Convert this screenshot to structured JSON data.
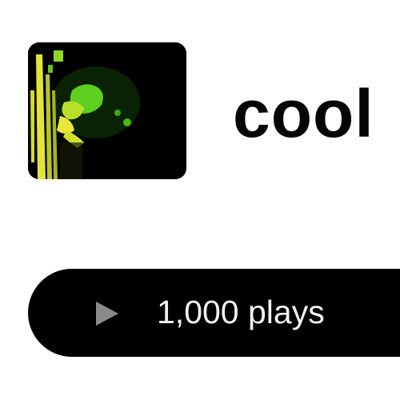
{
  "track": {
    "title": "cool",
    "artwork": {
      "icon": "cover-art",
      "colors": {
        "background": "#000000",
        "yellow": "#e8e83a",
        "green": "#5fcf1f"
      }
    }
  },
  "stats": {
    "plays_label": "1,000 plays",
    "play_icon": "play-icon",
    "pill_color": "#000000",
    "icon_color": "#8a8a8a"
  }
}
